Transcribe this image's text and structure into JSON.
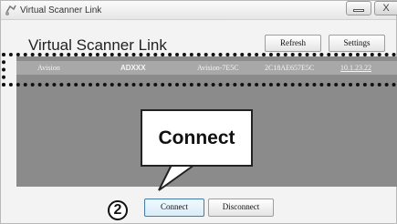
{
  "window": {
    "title": "Virtual Scanner Link",
    "close_label": "X"
  },
  "header": {
    "app_title": "Virtual Scanner Link",
    "refresh_label": "Refresh",
    "settings_label": "Settings"
  },
  "device_list": {
    "rows": [
      {
        "brand": "Avision",
        "model": "ADXXX",
        "name": "Avision-7E5C",
        "serial": "2C18AE657E5C",
        "ip": "10.1.23.22"
      }
    ]
  },
  "callout": {
    "text": "Connect"
  },
  "footer": {
    "step_number": "2",
    "connect_label": "Connect",
    "disconnect_label": "Disconnect"
  },
  "colors": {
    "panel": "#8b8b8b",
    "selected_row": "#a8a8a8",
    "highlight_border": "#111111"
  },
  "icons": {
    "window": "scanner-link-icon",
    "minimize": "minimize-icon",
    "close": "close-icon"
  }
}
